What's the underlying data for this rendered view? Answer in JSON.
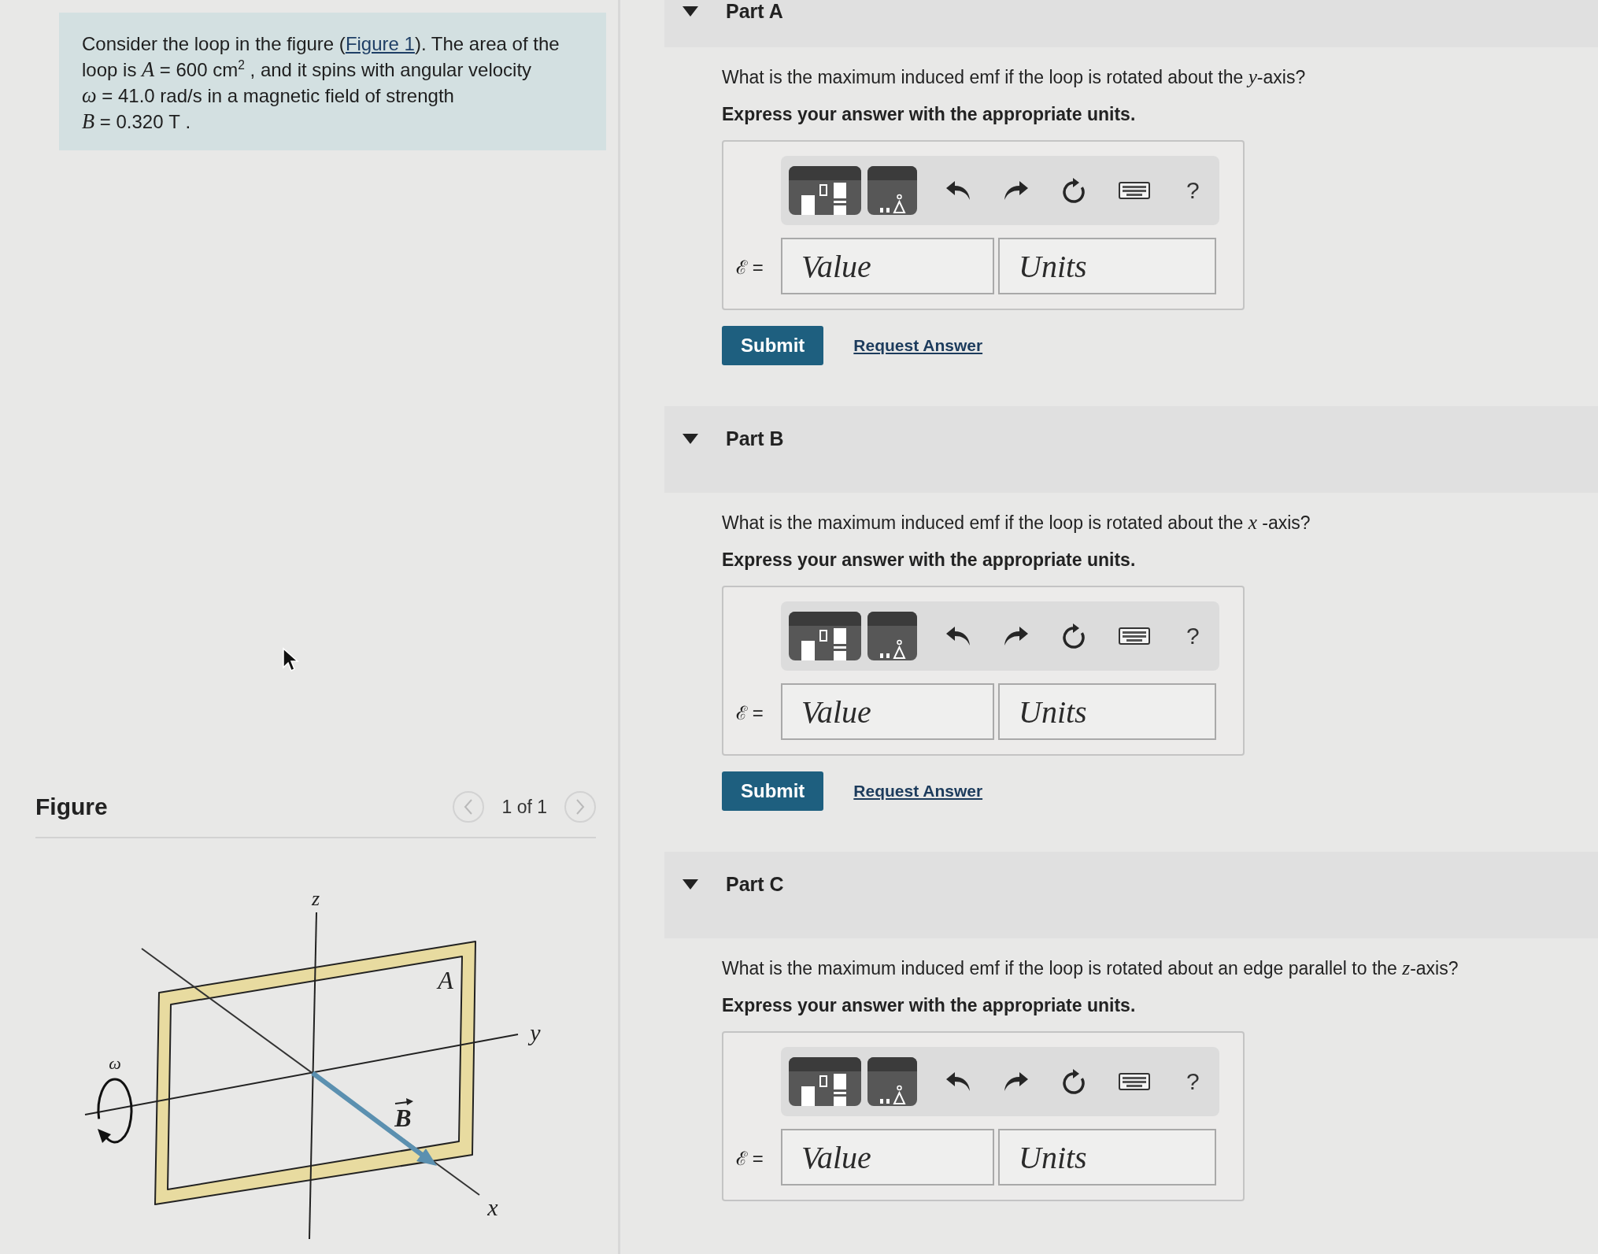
{
  "intro": {
    "before": "Consider the loop in the figure (",
    "link": "Figure 1",
    "after": "). The area of the loop is *A* = 600 cm$^{2}$ , and it spins with angular velocity *ω* = 41.0 rad/s in a magnetic field of strength *B* = 0.320 T ."
  },
  "figure": {
    "heading": "Figure",
    "pager": "1 of 1",
    "nav": [
      {
        "kind": "prev",
        "disabled": true
      },
      {
        "kind": "next",
        "disabled": true
      }
    ],
    "labels": [
      {
        "kind": "axis_z",
        "text": "z"
      },
      {
        "kind": "area",
        "text": "A"
      },
      {
        "kind": "axis_y",
        "text": "y"
      },
      {
        "kind": "omega",
        "text": "ω"
      },
      {
        "kind": "field",
        "text": "B"
      },
      {
        "kind": "axis_x",
        "text": "x"
      }
    ]
  },
  "parts": [
    {
      "title": "Part A",
      "expanded": true,
      "question": "What is the maximum induced emf if the loop is rotated about the *y*-axis?",
      "instruction": "Express your answer with the appropriate units.",
      "answer": {
        "label": "ℰ =",
        "help": "?",
        "fields": [
          {
            "kind": "value",
            "placeholder": "Value"
          },
          {
            "kind": "units",
            "placeholder": "Units"
          }
        ]
      },
      "submit": "Submit",
      "request": "Request Answer"
    },
    {
      "title": "Part B",
      "expanded": true,
      "question": "What is the maximum induced emf if the loop is rotated about the *x* -axis?",
      "instruction": "Express your answer with the appropriate units.",
      "answer": {
        "label": "ℰ =",
        "help": "?",
        "fields": [
          {
            "kind": "value",
            "placeholder": "Value"
          },
          {
            "kind": "units",
            "placeholder": "Units"
          }
        ]
      },
      "submit": "Submit",
      "request": "Request Answer"
    },
    {
      "title": "Part C",
      "expanded": true,
      "question": "What is the maximum induced emf if the loop is rotated about an edge parallel to the *z*-axis?",
      "instruction": "Express your answer with the appropriate units.",
      "answer": {
        "label": "ℰ =",
        "help": "?",
        "fields": [
          {
            "kind": "value",
            "placeholder": "Value"
          },
          {
            "kind": "units",
            "placeholder": "Units"
          }
        ]
      }
    }
  ]
}
